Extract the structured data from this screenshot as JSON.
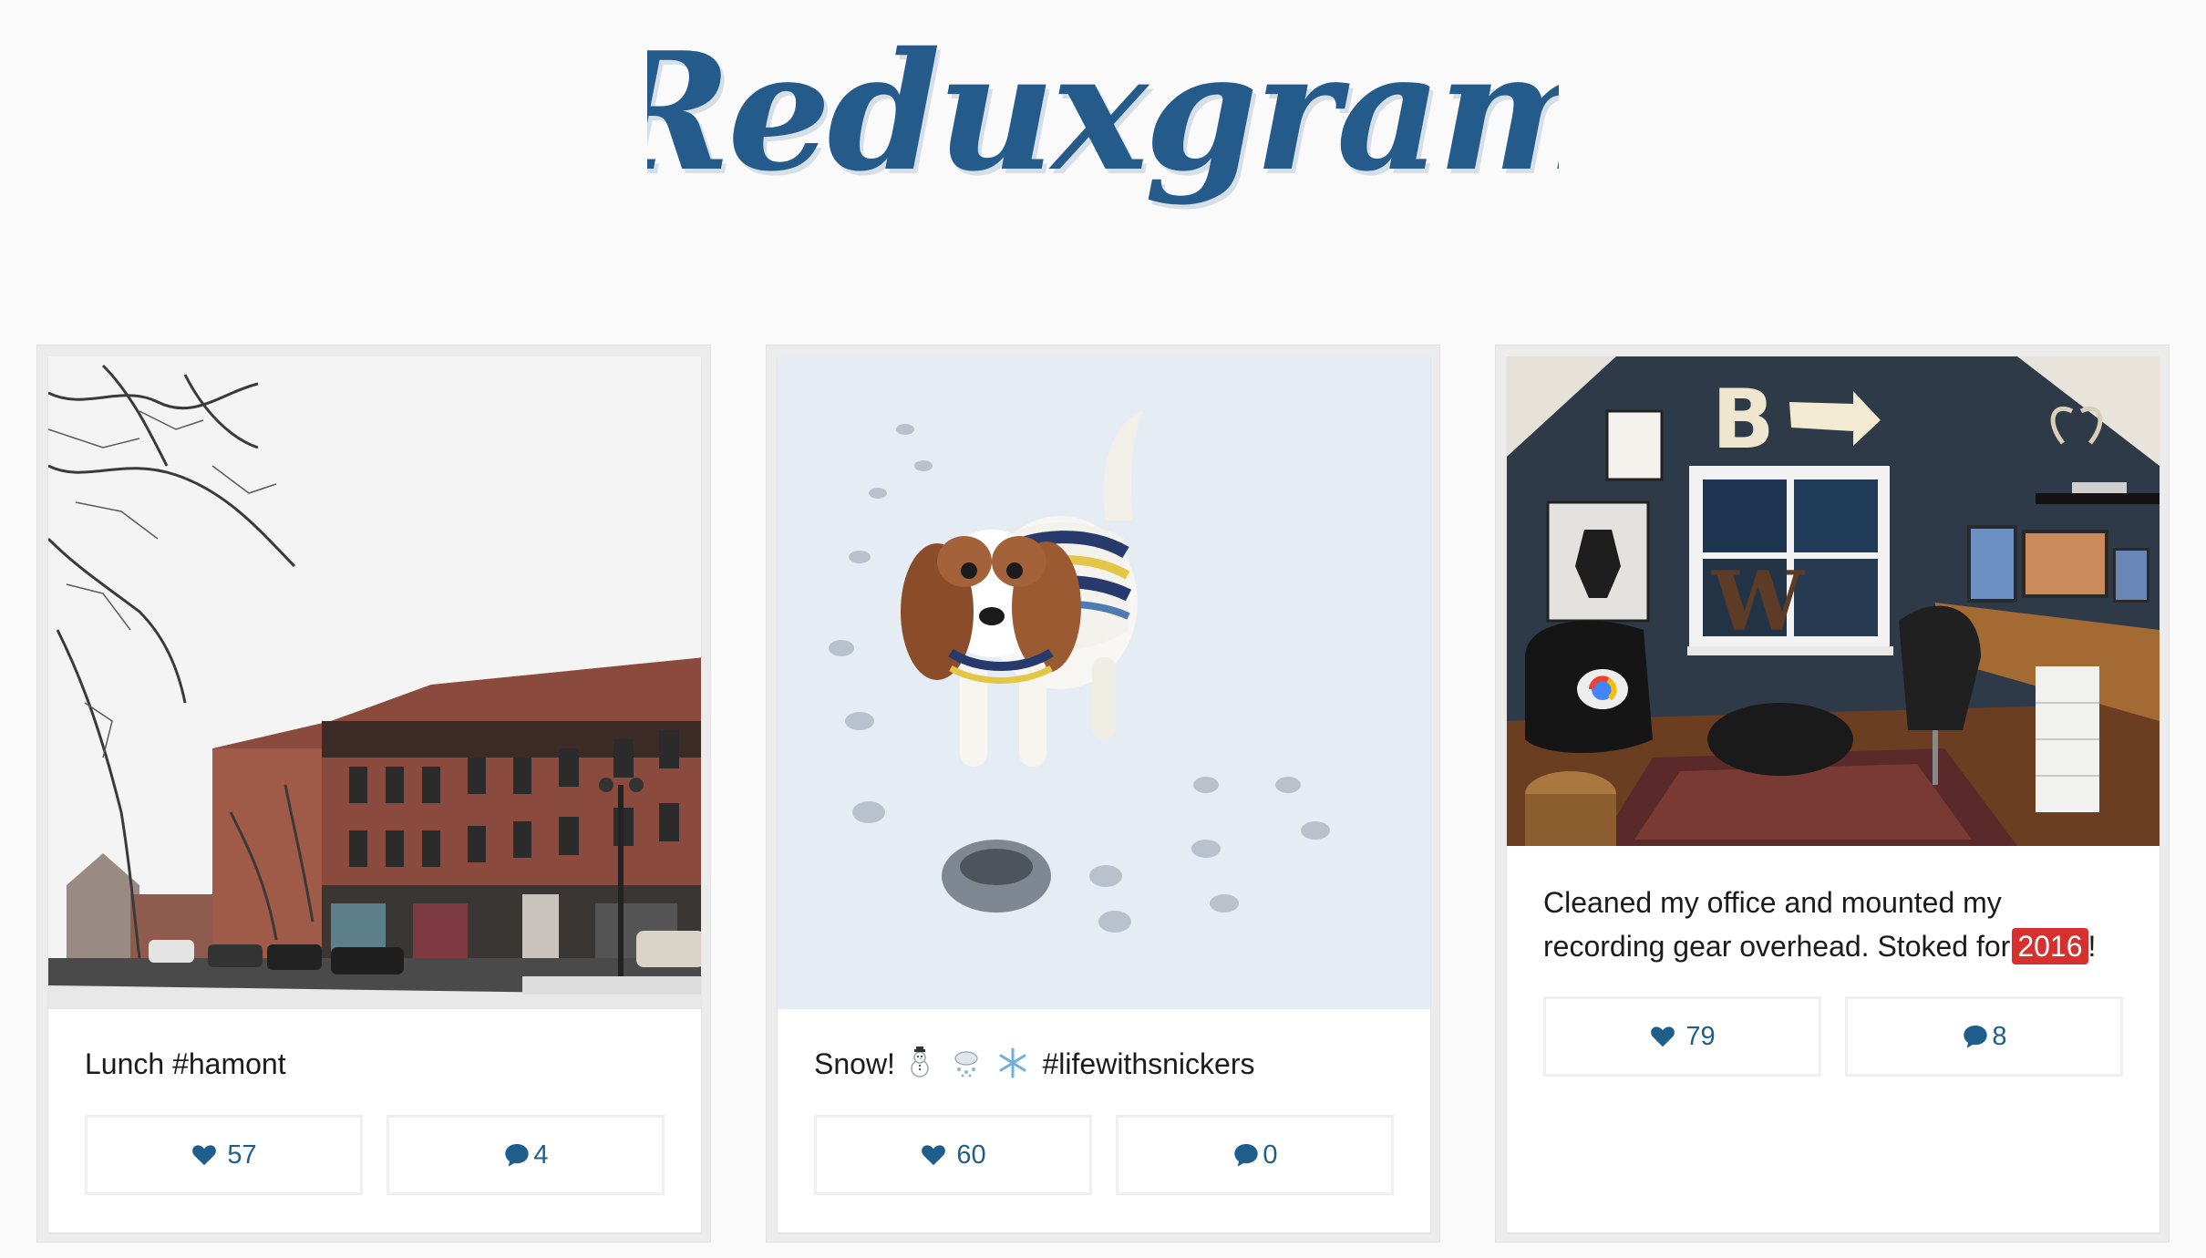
{
  "app": {
    "title": "Reduxgram",
    "brand_color": "#245b8a",
    "background": "#fafafa"
  },
  "posts": [
    {
      "photo": "snowy street with brick buildings and bare trees",
      "caption": "Lunch #hamont",
      "likes": "57",
      "comments": "4"
    },
    {
      "photo": "small spaniel dog in striped sweater standing in snow",
      "caption_prefix": "Snow!",
      "caption_emoji": [
        "snowman-icon",
        "snow-cloud-icon",
        "snowflake-icon"
      ],
      "caption_suffix": "#lifewithsnickers",
      "likes": "60",
      "comments": "0"
    },
    {
      "photo": "home office with lounge chair, window, marquee letters and desk with monitors",
      "caption_main": "Cleaned my office and mounted my recording gear overhead. Stoked for",
      "caption_tag": "2016",
      "caption_end": "!",
      "tag_color": "#d6312e",
      "likes": "79",
      "comments": "8"
    }
  ],
  "icons": {
    "like": "heart-icon",
    "comment": "speech-bubble-icon"
  }
}
